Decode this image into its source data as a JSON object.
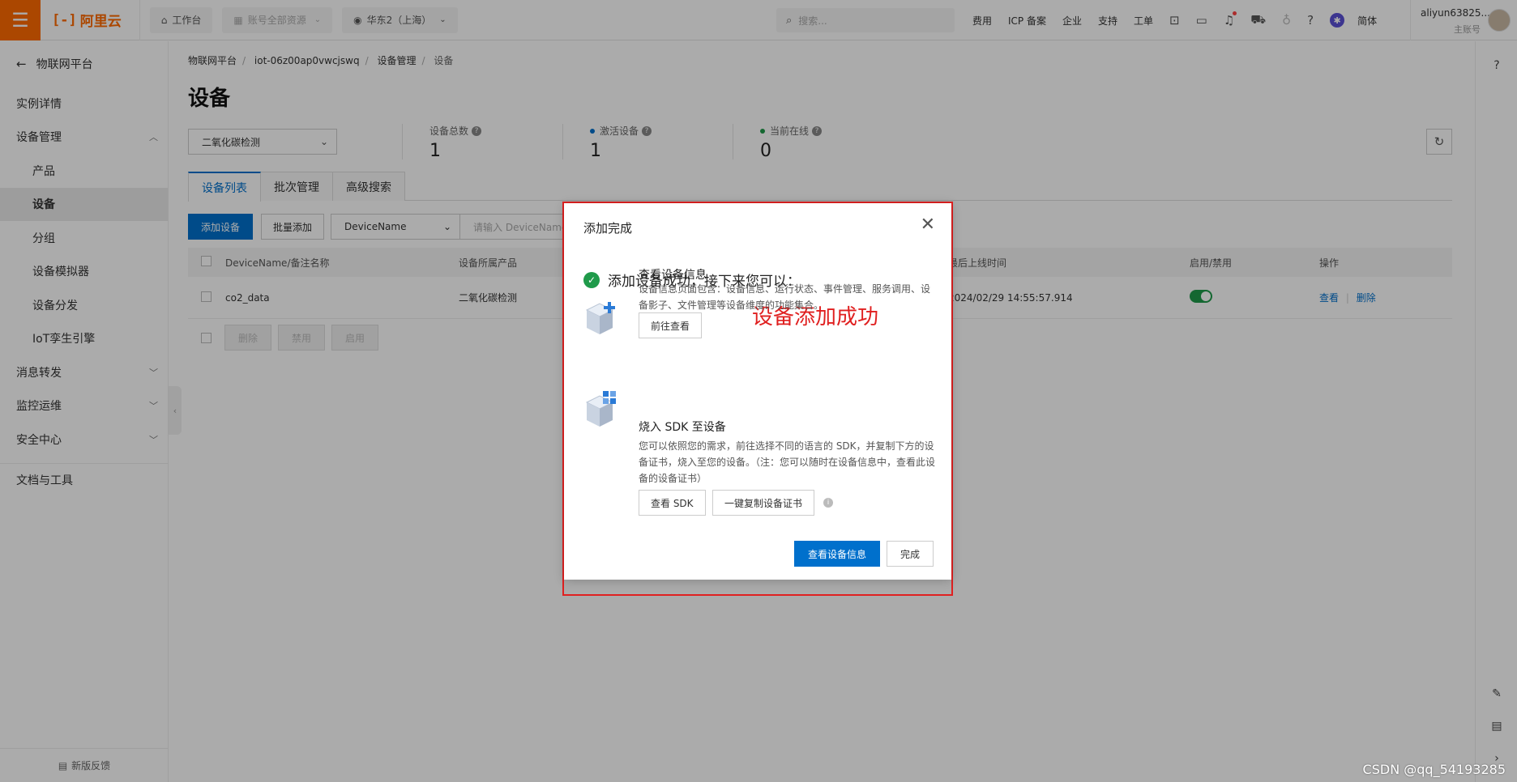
{
  "topbar": {
    "logo_mark": "[-]",
    "logo_text": "阿里云",
    "workbench": "工作台",
    "resources": "账号全部资源",
    "region": "华东2（上海）",
    "search_placeholder": "搜索...",
    "links": [
      "费用",
      "ICP 备案",
      "企业",
      "支持",
      "工单"
    ],
    "lang": "简体",
    "account_name": "aliyun63825....",
    "account_role": "主账号"
  },
  "sidebar": {
    "back_label": "物联网平台",
    "items": [
      {
        "label": "实例详情",
        "level": 0
      },
      {
        "label": "设备管理",
        "level": 0,
        "expanded": true
      },
      {
        "label": "产品",
        "level": 1
      },
      {
        "label": "设备",
        "level": 1,
        "active": true
      },
      {
        "label": "分组",
        "level": 1
      },
      {
        "label": "设备模拟器",
        "level": 1
      },
      {
        "label": "设备分发",
        "level": 1
      },
      {
        "label": "IoT孪生引擎",
        "level": 1
      },
      {
        "label": "消息转发",
        "level": 0,
        "expanded": false
      },
      {
        "label": "监控运维",
        "level": 0,
        "expanded": false
      },
      {
        "label": "安全中心",
        "level": 0,
        "expanded": false
      }
    ],
    "docs_label": "文档与工具",
    "feedback_label": "新版反馈"
  },
  "main": {
    "breadcrumb": [
      "物联网平台",
      "iot-06z00ap0vwcjswq",
      "设备管理",
      "设备"
    ],
    "title": "设备",
    "product_select": "二氧化碳检测",
    "stats": {
      "total_label": "设备总数",
      "total_value": "1",
      "active_label": "激活设备",
      "active_value": "1",
      "online_label": "当前在线",
      "online_value": "0"
    },
    "tabs": [
      "设备列表",
      "批次管理",
      "高级搜索"
    ],
    "toolbar": {
      "add_device": "添加设备",
      "bulk_add": "批量添加",
      "filter_field": "DeviceName",
      "filter_placeholder": "请输入 DeviceName"
    },
    "table": {
      "headers": [
        "DeviceName/备注名称",
        "设备所属产品",
        "最后上线时间",
        "启用/禁用",
        "操作"
      ],
      "rows": [
        {
          "name": "co2_data",
          "product": "二氧化碳检测",
          "last_online": "2024/02/29 14:55:57.914",
          "enabled": true,
          "actions": [
            "查看",
            "删除"
          ]
        }
      ]
    },
    "bulk_actions": [
      "删除",
      "禁用",
      "启用"
    ]
  },
  "dialog": {
    "title": "添加完成",
    "success_text": "添加设备成功，接下来您可以：",
    "annotation": "设备添加成功",
    "section1": {
      "title": "查看设备信息",
      "desc": "设备信息页面包含：设备信息、运行状态、事件管理、服务调用、设备影子、文件管理等设备维度的功能集合。",
      "button": "前往查看"
    },
    "section2": {
      "title": "烧入 SDK 至设备",
      "desc": "您可以依照您的需求，前往选择不同的语言的 SDK，并复制下方的设备证书，烧入至您的设备。（注：您可以随时在设备信息中，查看此设备的设备证书）",
      "button1": "查看 SDK",
      "button2": "一键复制设备证书"
    },
    "primary_button": "查看设备信息",
    "done_button": "完成"
  },
  "watermark": "CSDN @qq_54193285",
  "colors": {
    "brand": "#ff6a00",
    "primary": "#0070cc",
    "success": "#1f9a4a",
    "annotation": "#e02020"
  }
}
